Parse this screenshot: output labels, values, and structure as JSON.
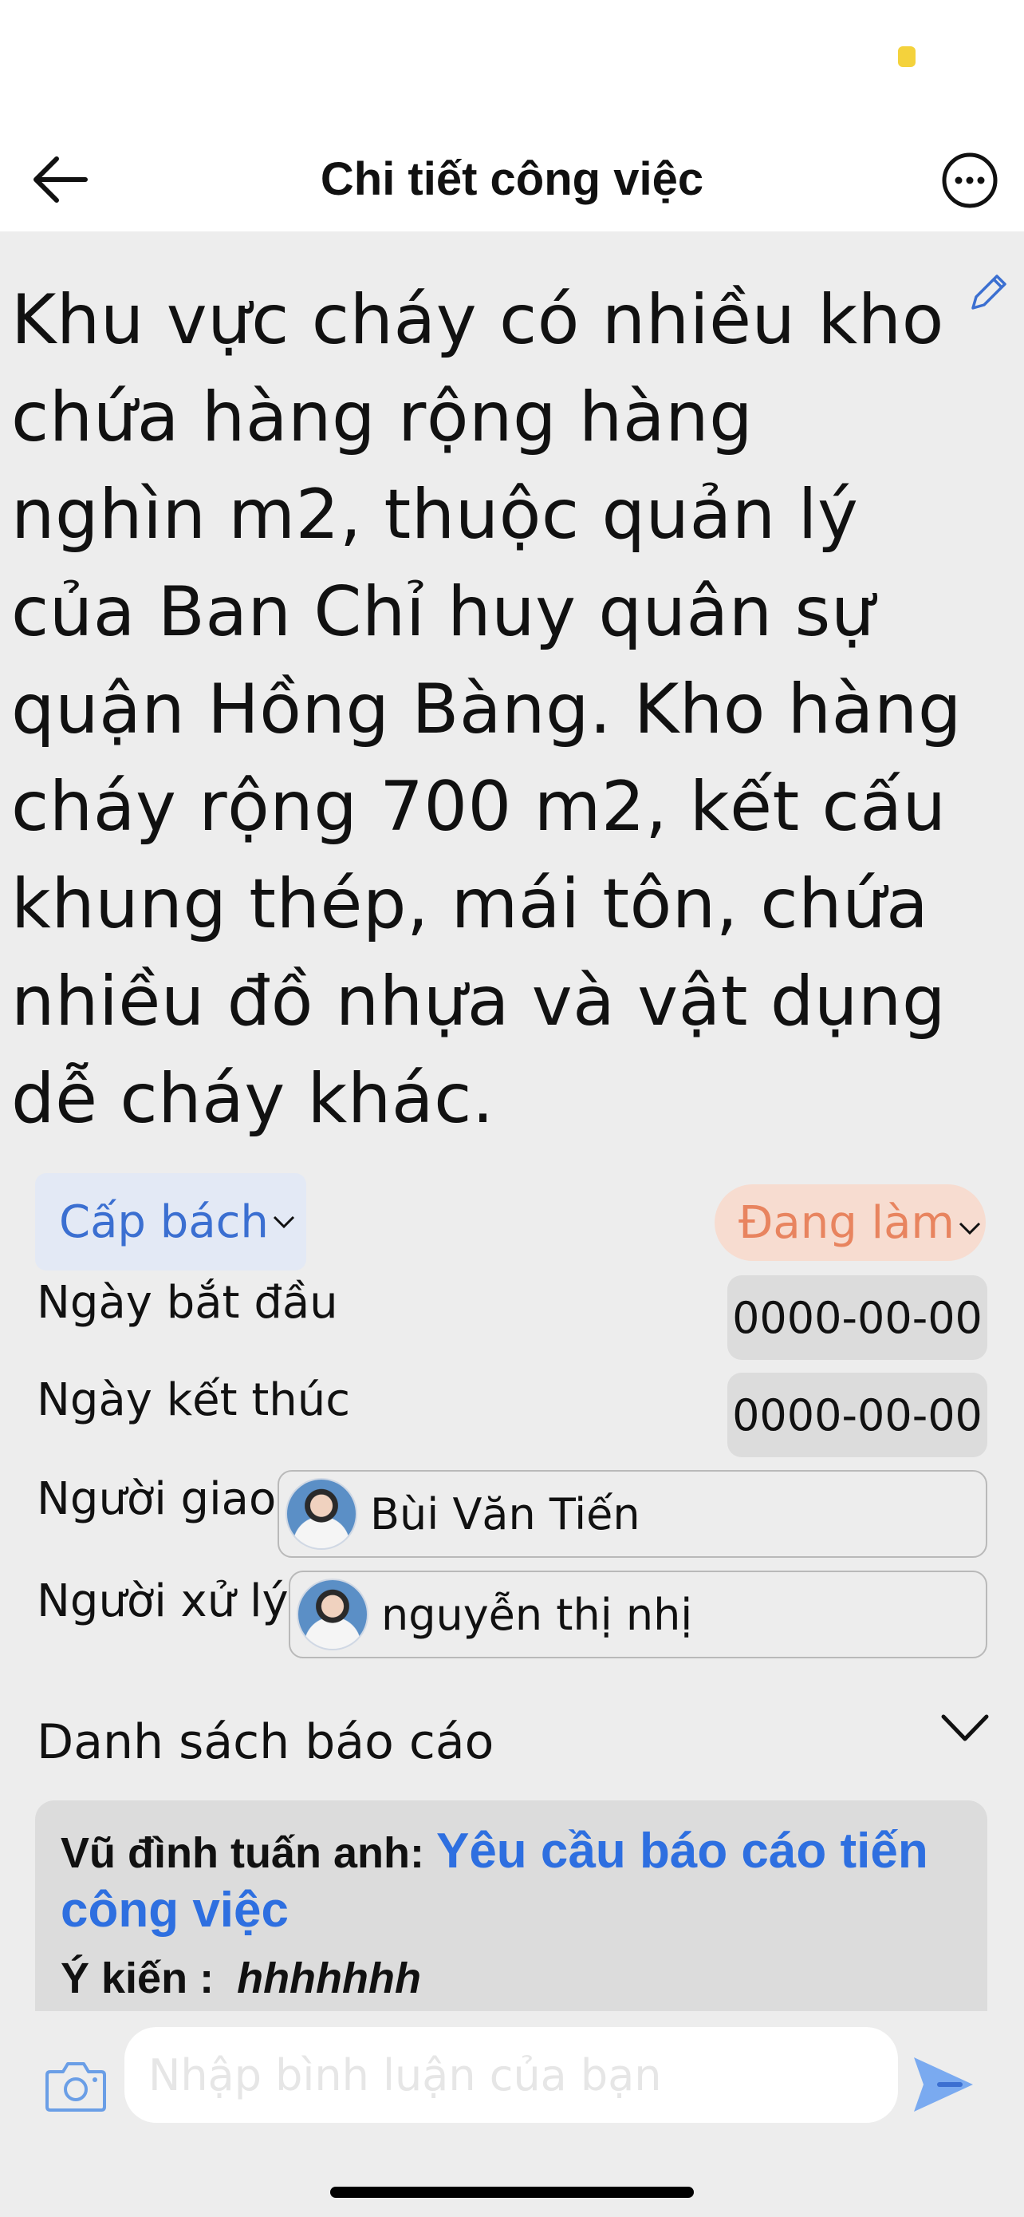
{
  "header": {
    "title": "Chi tiết công việc",
    "back_icon": "arrow-left-icon",
    "more_icon": "more-horizontal-icon"
  },
  "task": {
    "description": "Khu vực cháy có nhiều kho chứa hàng rộng hàng nghìn m2, thuộc quản lý của Ban Chỉ huy quân sự quận Hồng Bàng. Kho hàng cháy rộng 700 m2, kết cấu khung thép, mái tôn, chứa nhiều đồ nhựa và vật dụng dễ cháy khác.",
    "edit_icon": "pencil-icon",
    "priority": "Cấp bách",
    "status": "Đang làm"
  },
  "fields": {
    "start_label": "Ngày bắt đầu",
    "start_value": "0000-00-00",
    "end_label": "Ngày kết thúc",
    "end_value": "0000-00-00",
    "assigner_label": "Người giao",
    "assigner_name": "Bùi Văn Tiến",
    "handler_label": "Người xử lý",
    "handler_name": "nguyễn thị nhị"
  },
  "reports": {
    "title": "Danh sách báo cáo",
    "items": [
      {
        "author": "Vũ đình tuấn anh:",
        "request": "Yêu cầu báo cáo tiến công việc",
        "opinion_label": "Ý kiến :",
        "opinion_value": "hhhhhhh"
      }
    ]
  },
  "comment": {
    "placeholder": "Nhập bình luận của bạn",
    "camera_icon": "camera-icon",
    "send_icon": "send-icon"
  },
  "colors": {
    "accent": "#2e6fe0",
    "priority_bg": "#e3e9f5",
    "status_bg": "#f7dcd0",
    "status_text": "#e8845f"
  }
}
